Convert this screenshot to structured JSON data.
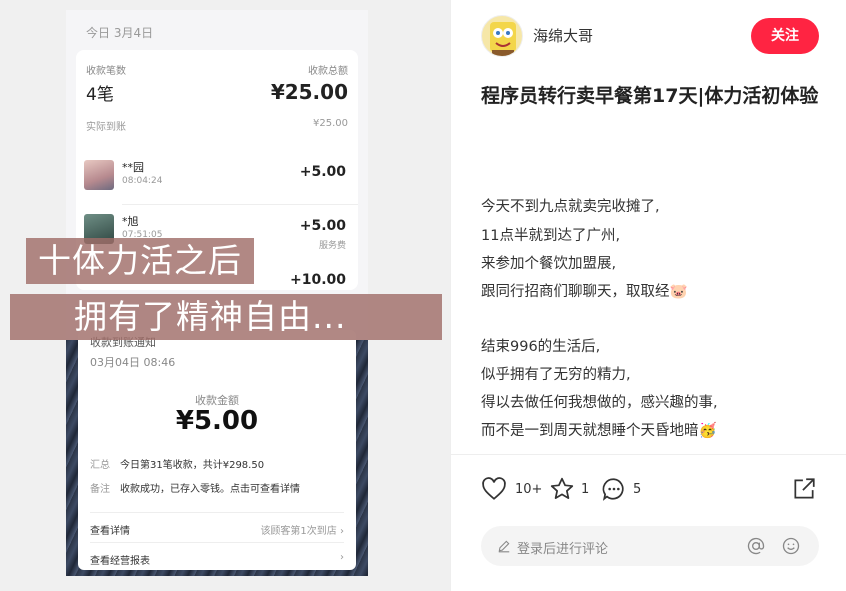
{
  "left_image": {
    "date_header": "今日 3月4日",
    "summary": {
      "count_label": "收款笔数",
      "count_value": "4笔",
      "total_label": "收款总额",
      "total_value": "¥25.00",
      "received_label": "实际到账",
      "received_value": "¥25.00"
    },
    "transactions": [
      {
        "name": "**园",
        "time": "08:04:24",
        "amount": "+5.00",
        "note": ""
      },
      {
        "name": "*旭",
        "time": "07:51:05",
        "amount": "+5.00",
        "note": "服务费"
      },
      {
        "name": "",
        "time": "",
        "amount": "+10.00",
        "note": ""
      }
    ],
    "notice": {
      "title": "收款到账通知",
      "time": "03月04日 08:46",
      "amount_label": "收款金额",
      "amount": "¥5.00",
      "summary_key": "汇总",
      "summary_val": "今日第31笔收款，共计¥298.50",
      "remark_key": "备注",
      "remark_val": "收款成功，已存入零钱。点击可查看详情",
      "link1": "查看详情",
      "link1_right": "该顾客第1次到店",
      "link2": "查看经营报表"
    },
    "captions": [
      "十体力活之后",
      "拥有了精神自由..."
    ]
  },
  "post": {
    "author": "海绵大哥",
    "follow_label": "关注",
    "title": "程序员转行卖早餐第17天|体力活初体验",
    "paragraphs": [
      [
        "今天不到九点就卖完收摊了,",
        "11点半就到达了广州,",
        "来参加个餐饮加盟展,",
        "跟同行招商们聊聊天，取取经🐷"
      ],
      [
        "结束996的生活后,",
        "似乎拥有了无穷的精力,",
        "得以去做任何我想做的，感兴趣的事,",
        "而不是一到周天就想睡个天昏地暗🥳"
      ]
    ],
    "likes": "10+",
    "collects": "1",
    "comments": "5",
    "comment_placeholder": "登录后进行评论"
  },
  "colors": {
    "follow_bg": "#ff2442",
    "caption_bg": "#a06e69"
  }
}
